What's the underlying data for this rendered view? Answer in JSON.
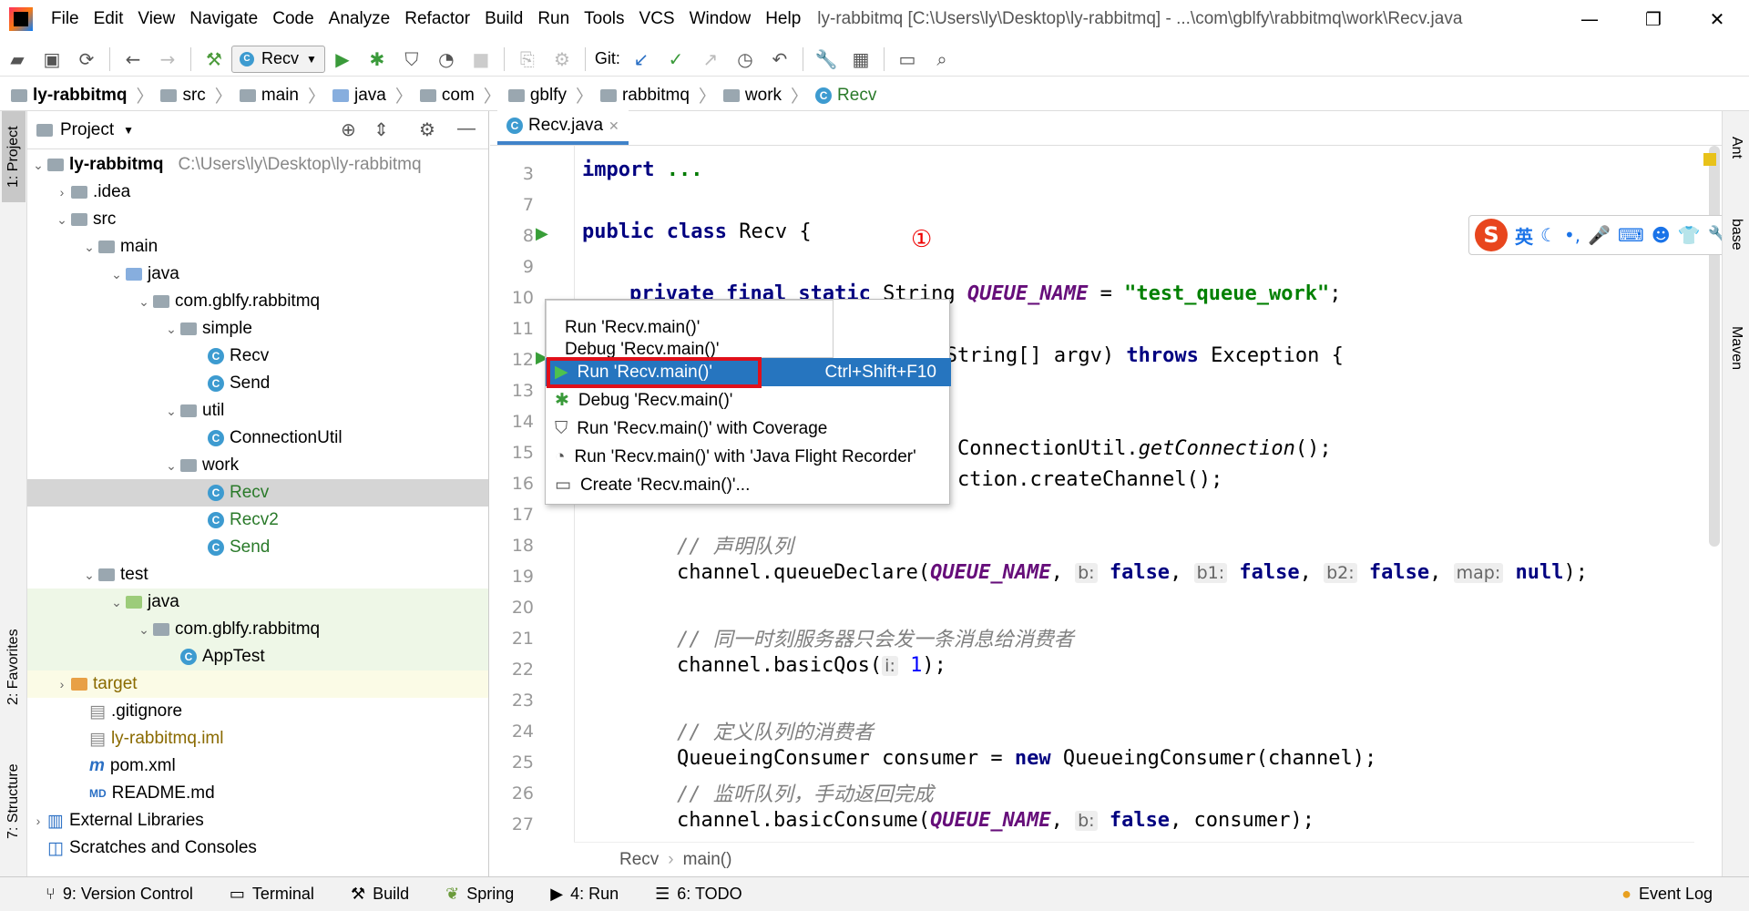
{
  "window": {
    "title": "ly-rabbitmq [C:\\Users\\ly\\Desktop\\ly-rabbitmq] - ...\\com\\gblfy\\rabbitmq\\work\\Recv.java",
    "menu": [
      "File",
      "Edit",
      "View",
      "Navigate",
      "Code",
      "Analyze",
      "Refactor",
      "Build",
      "Run",
      "Tools",
      "VCS",
      "Window",
      "Help"
    ],
    "controls": {
      "minimize": "—",
      "restore": "❐",
      "close": "✕"
    }
  },
  "toolbar": {
    "run_config": "Recv",
    "git_label": "Git:"
  },
  "breadcrumbs": [
    "ly-rabbitmq",
    "src",
    "main",
    "java",
    "com",
    "gblfy",
    "rabbitmq",
    "work",
    "Recv"
  ],
  "left_strip": {
    "project_tab": "1: Project",
    "favorites_tab": "2: Favorites",
    "structure_tab": "7: Structure"
  },
  "project_panel": {
    "title": "Project",
    "tree": [
      {
        "label": "ly-rabbitmq",
        "path": "C:\\Users\\ly\\Desktop\\ly-rabbitmq"
      },
      {
        "label": ".idea"
      },
      {
        "label": "src"
      },
      {
        "label": "main"
      },
      {
        "label": "java"
      },
      {
        "label": "com.gblfy.rabbitmq"
      },
      {
        "label": "simple"
      },
      {
        "label": "Recv"
      },
      {
        "label": "Send"
      },
      {
        "label": "util"
      },
      {
        "label": "ConnectionUtil"
      },
      {
        "label": "work"
      },
      {
        "label": "Recv"
      },
      {
        "label": "Recv2"
      },
      {
        "label": "Send"
      },
      {
        "label": "test"
      },
      {
        "label": "java"
      },
      {
        "label": "com.gblfy.rabbitmq"
      },
      {
        "label": "AppTest"
      },
      {
        "label": "target"
      },
      {
        "label": ".gitignore"
      },
      {
        "label": "ly-rabbitmq.iml"
      },
      {
        "label": "pom.xml"
      },
      {
        "label": "README.md"
      },
      {
        "label": "External Libraries"
      },
      {
        "label": "Scratches and Consoles"
      }
    ]
  },
  "editor": {
    "tab": "Recv.java",
    "line_numbers": [
      "3",
      "7",
      "8",
      "9",
      "10",
      "11",
      "12",
      "13",
      "14",
      "15",
      "16",
      "17",
      "18",
      "19",
      "20",
      "21",
      "22",
      "23",
      "24",
      "25",
      "26",
      "27"
    ],
    "code": {
      "l3_kw": "import",
      "l3_rest": " ...",
      "l8_kw": "public class",
      "l8_rest": " Recv {",
      "l10_kw": "private final static",
      "l10_type": " String ",
      "l10_field": "QUEUE_NAME",
      "l10_eq": " = ",
      "l10_str": "\"test_queue_work\"",
      "l10_end": ";",
      "l12_a": "d main(String[] argv) ",
      "l12_kw": "throws",
      "l12_b": " Exception {",
      "l15_a": "ConnectionUtil.",
      "l15_m": "getConnection",
      "l15_b": "();",
      "l16_a": "ction.createChannel();",
      "l18_cmt": "// 声明队列",
      "l19_a": "channel.queueDeclare(",
      "l19_f": "QUEUE_NAME",
      "l19_h1": "b:",
      "l19_h2": "b1:",
      "l19_h3": "b2:",
      "l19_h4": "map:",
      "l19_false": "false",
      "l19_null": "null",
      "l19_end": ");",
      "l21_cmt": "// 同一时刻服务器只会发一条消息给消费者",
      "l22_a": "channel.basicQos(",
      "l22_h": "i:",
      "l22_n": "1",
      "l22_end": ");",
      "l24_cmt": "// 定义队列的消费者",
      "l25_a": "QueueingConsumer consumer = ",
      "l25_kw": "new",
      "l25_b": " QueueingConsumer(channel);",
      "l26_cmt": "// 监听队列，手动返回完成",
      "l27_a": "channel.basicConsume(",
      "l27_f": "QUEUE_NAME",
      "l27_h": "b:",
      "l27_false": "false",
      "l27_b": ", consumer);"
    },
    "footer_crumbs": [
      "Recv",
      "main()"
    ],
    "annotation_marker": "①"
  },
  "popup": {
    "header_items": [
      "Run 'Recv.main()'",
      "Debug 'Recv.main()'"
    ],
    "items": [
      {
        "label": "Run 'Recv.main()'",
        "shortcut": "Ctrl+Shift+F10"
      },
      {
        "label": "Debug 'Recv.main()'"
      },
      {
        "label": "Run 'Recv.main()' with Coverage"
      },
      {
        "label": "Run 'Recv.main()' with 'Java Flight Recorder'"
      },
      {
        "label": "Create 'Recv.main()'..."
      }
    ]
  },
  "ime_bar": {
    "mode": "英"
  },
  "right_strip": {
    "ant": "Ant",
    "database": "base",
    "maven": "Maven"
  },
  "bottom_bar": {
    "version_control": "9: Version Control",
    "terminal": "Terminal",
    "build": "Build",
    "spring": "Spring",
    "run": "4: Run",
    "todo": "6: TODO",
    "event_log": "Event Log"
  },
  "colors": {
    "accent": "#2675bf",
    "highlight_box": "#e0101a",
    "keyword": "#000080",
    "string": "#008000",
    "field": "#660e7a"
  }
}
